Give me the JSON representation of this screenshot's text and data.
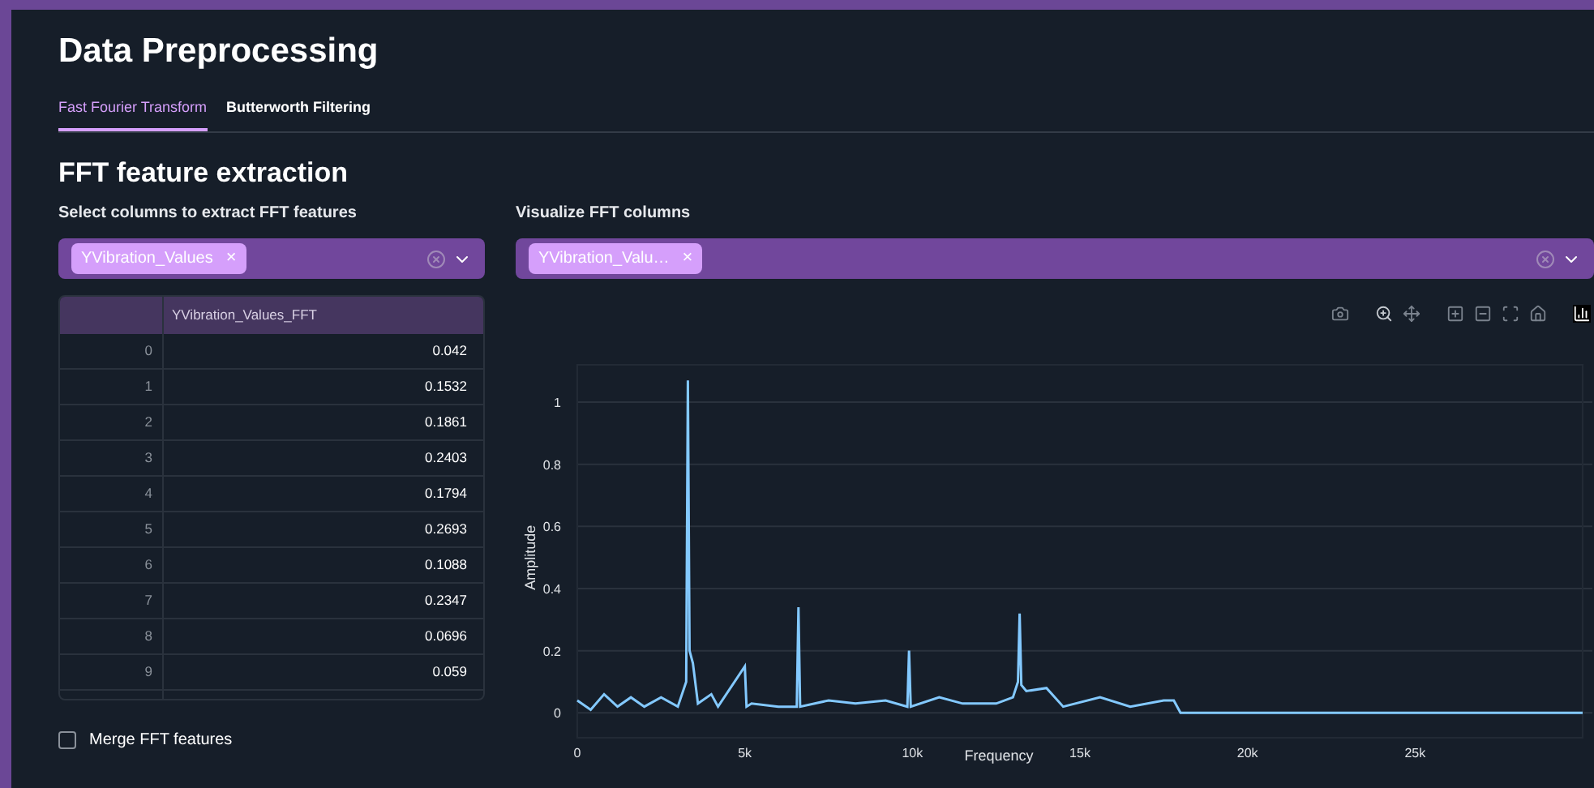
{
  "title": "Data Preprocessing",
  "tabs": [
    {
      "label": "Fast Fourier Transform",
      "selected": true
    },
    {
      "label": "Butterworth Filtering",
      "selected": false
    }
  ],
  "section_title": "FFT feature extraction",
  "extract_select": {
    "label": "Select columns to extract FFT features",
    "chips": [
      "YVibration_Values"
    ],
    "remove": "×"
  },
  "table": {
    "columns": [
      "YVibration_Values_FFT"
    ],
    "rows": [
      {
        "index": "0",
        "value": "0.042"
      },
      {
        "index": "1",
        "value": "0.1532"
      },
      {
        "index": "2",
        "value": "0.1861"
      },
      {
        "index": "3",
        "value": "0.2403"
      },
      {
        "index": "4",
        "value": "0.1794"
      },
      {
        "index": "5",
        "value": "0.2693"
      },
      {
        "index": "6",
        "value": "0.1088"
      },
      {
        "index": "7",
        "value": "0.2347"
      },
      {
        "index": "8",
        "value": "0.0696"
      },
      {
        "index": "9",
        "value": "0.059"
      }
    ]
  },
  "merge_checkbox": {
    "label": "Merge FFT features",
    "checked": false
  },
  "visualize_select": {
    "label": "Visualize FFT columns",
    "chips": [
      "YVibration_Valu…"
    ],
    "remove": "×"
  },
  "chart": {
    "chart_data": {
      "type": "line",
      "xlabel": "Frequency",
      "ylabel": "Amplitude",
      "grid": true,
      "xlim": [
        0,
        30000
      ],
      "ylim": [
        -0.08,
        1.12
      ],
      "xticks": [
        {
          "value": 0,
          "label": "0"
        },
        {
          "value": 5000,
          "label": "5k"
        },
        {
          "value": 10000,
          "label": "10k"
        },
        {
          "value": 15000,
          "label": "15k"
        },
        {
          "value": 20000,
          "label": "20k"
        },
        {
          "value": 25000,
          "label": "25k"
        }
      ],
      "yticks": [
        {
          "value": 0,
          "label": "0"
        },
        {
          "value": 0.2,
          "label": "0.2"
        },
        {
          "value": 0.4,
          "label": "0.4"
        },
        {
          "value": 0.6,
          "label": "0.6"
        },
        {
          "value": 0.8,
          "label": "0.8"
        },
        {
          "value": 1,
          "label": "1"
        }
      ],
      "x": [
        0,
        400,
        800,
        1200,
        1600,
        2000,
        2500,
        3000,
        3250,
        3300,
        3350,
        3450,
        3600,
        4000,
        4200,
        5000,
        5050,
        5200,
        6000,
        6550,
        6600,
        6650,
        7500,
        8300,
        9200,
        9850,
        9900,
        9950,
        10800,
        11500,
        12500,
        13000,
        13150,
        13200,
        13250,
        13400,
        14000,
        14500,
        15600,
        16500,
        17500,
        17800,
        18000,
        20000,
        25000,
        30000
      ],
      "series": [
        {
          "color": "#83c9ff",
          "values": [
            0.04,
            0.01,
            0.06,
            0.02,
            0.05,
            0.02,
            0.05,
            0.02,
            0.1,
            1.07,
            0.2,
            0.16,
            0.03,
            0.06,
            0.02,
            0.15,
            0.02,
            0.03,
            0.02,
            0.02,
            0.34,
            0.02,
            0.04,
            0.03,
            0.04,
            0.02,
            0.2,
            0.02,
            0.05,
            0.03,
            0.03,
            0.05,
            0.1,
            0.32,
            0.09,
            0.07,
            0.08,
            0.02,
            0.05,
            0.02,
            0.04,
            0.04,
            0,
            0,
            0,
            0
          ]
        }
      ]
    }
  }
}
